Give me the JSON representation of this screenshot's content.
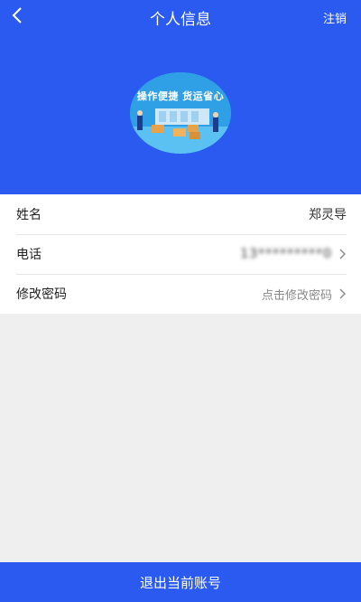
{
  "header": {
    "title": "个人信息",
    "logout_label": "注销",
    "back_icon": "chevron-left-icon",
    "background_color": "#2a5af0"
  },
  "avatar": {
    "banner_text": "操作便捷  货运省心"
  },
  "profile": {
    "rows": [
      {
        "label": "姓名",
        "value": "郑灵导"
      },
      {
        "label": "电话",
        "value": "13*********0"
      },
      {
        "label": "修改密码",
        "value": "点击修改密码"
      }
    ]
  },
  "footer": {
    "logout_button_label": "退出当前账号"
  }
}
